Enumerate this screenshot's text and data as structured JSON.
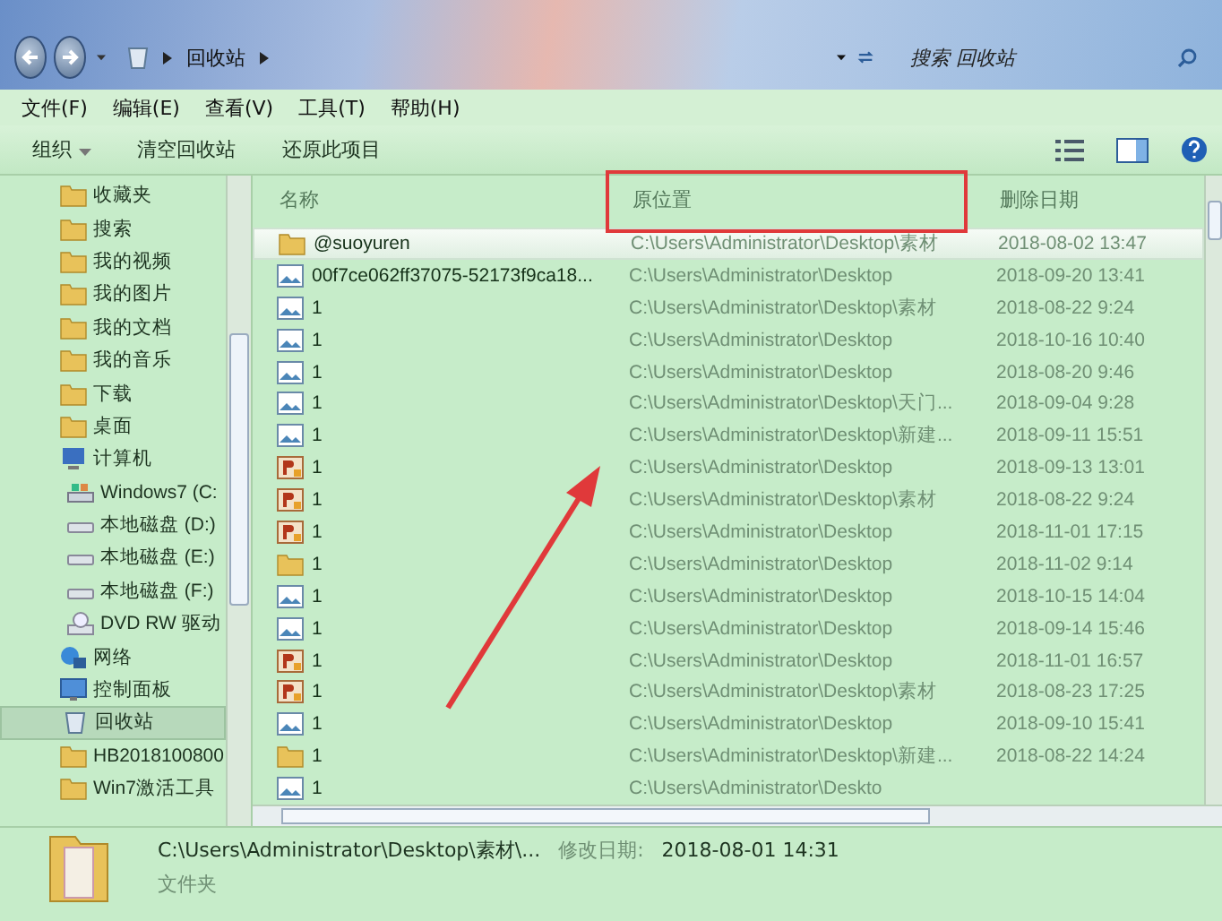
{
  "address_bar": {
    "crumbs": [
      "回收站"
    ],
    "search": {
      "placeholder": "搜索 回收站"
    }
  },
  "menu": [
    "文件(F)",
    "编辑(E)",
    "查看(V)",
    "工具(T)",
    "帮助(H)"
  ],
  "toolbar": {
    "organize": "组织",
    "buttons": [
      "清空回收站",
      "还原此项目"
    ]
  },
  "sidebar": {
    "items": [
      {
        "label": "收藏夹",
        "kind": "folder",
        "selected": false
      },
      {
        "label": "搜索",
        "kind": "folder",
        "selected": false
      },
      {
        "label": "我的视频",
        "kind": "folder",
        "selected": false
      },
      {
        "label": "我的图片",
        "kind": "folder",
        "selected": false
      },
      {
        "label": "我的文档",
        "kind": "folder",
        "selected": false
      },
      {
        "label": "我的音乐",
        "kind": "folder",
        "selected": false
      },
      {
        "label": "下载",
        "kind": "folder",
        "selected": false
      },
      {
        "label": "桌面",
        "kind": "folder",
        "selected": false
      },
      {
        "label": "计算机",
        "kind": "computer",
        "selected": false,
        "children": [
          {
            "label": "Windows7 (C:",
            "kind": "system-drive",
            "selected": false
          },
          {
            "label": "本地磁盘 (D:)",
            "kind": "drive",
            "selected": false
          },
          {
            "label": "本地磁盘 (E:)",
            "kind": "drive",
            "selected": false
          },
          {
            "label": "本地磁盘 (F:)",
            "kind": "drive",
            "selected": false
          },
          {
            "label": "DVD RW 驱动",
            "kind": "dvd",
            "selected": false
          }
        ]
      },
      {
        "label": "网络",
        "kind": "network",
        "selected": false
      },
      {
        "label": "控制面板",
        "kind": "panel",
        "selected": false
      },
      {
        "label": "回收站",
        "kind": "bin",
        "selected": true
      },
      {
        "label": "HB2018100800",
        "kind": "folder",
        "selected": false
      },
      {
        "label": "Win7激活工具",
        "kind": "folder",
        "selected": false
      }
    ]
  },
  "table": {
    "columns": [
      "名称",
      "原位置",
      "删除日期"
    ],
    "rows": [
      {
        "kind": "folder",
        "name": "@suoyuren",
        "location": "C:\\Users\\Administrator\\Desktop\\素材",
        "date": "2018-08-02 13:47",
        "selected": true
      },
      {
        "kind": "image",
        "name": "00f7ce062ff37075-52173f9ca18...",
        "location": "C:\\Users\\Administrator\\Desktop",
        "date": "2018-09-20 13:41",
        "selected": false
      },
      {
        "kind": "image",
        "name": "1",
        "location": "C:\\Users\\Administrator\\Desktop\\素材",
        "date": "2018-08-22 9:24",
        "selected": false
      },
      {
        "kind": "image",
        "name": "1",
        "location": "C:\\Users\\Administrator\\Desktop",
        "date": "2018-10-16 10:40",
        "selected": false
      },
      {
        "kind": "image",
        "name": "1",
        "location": "C:\\Users\\Administrator\\Desktop",
        "date": "2018-08-20 9:46",
        "selected": false
      },
      {
        "kind": "image",
        "name": "1",
        "location": "C:\\Users\\Administrator\\Desktop\\天门...",
        "date": "2018-09-04 9:28",
        "selected": false
      },
      {
        "kind": "image",
        "name": "1",
        "location": "C:\\Users\\Administrator\\Desktop\\新建...",
        "date": "2018-09-11 15:51",
        "selected": false
      },
      {
        "kind": "psd",
        "name": "1",
        "location": "C:\\Users\\Administrator\\Desktop",
        "date": "2018-09-13 13:01",
        "selected": false
      },
      {
        "kind": "psd",
        "name": "1",
        "location": "C:\\Users\\Administrator\\Desktop\\素材",
        "date": "2018-08-22 9:24",
        "selected": false
      },
      {
        "kind": "psd",
        "name": "1",
        "location": "C:\\Users\\Administrator\\Desktop",
        "date": "2018-11-01 17:15",
        "selected": false
      },
      {
        "kind": "folder",
        "name": "1",
        "location": "C:\\Users\\Administrator\\Desktop",
        "date": "2018-11-02 9:14",
        "selected": false
      },
      {
        "kind": "image",
        "name": "1",
        "location": "C:\\Users\\Administrator\\Desktop",
        "date": "2018-10-15 14:04",
        "selected": false
      },
      {
        "kind": "image",
        "name": "1",
        "location": "C:\\Users\\Administrator\\Desktop",
        "date": "2018-09-14 15:46",
        "selected": false
      },
      {
        "kind": "psd",
        "name": "1",
        "location": "C:\\Users\\Administrator\\Desktop",
        "date": "2018-11-01 16:57",
        "selected": false
      },
      {
        "kind": "psd",
        "name": "1",
        "location": "C:\\Users\\Administrator\\Desktop\\素材",
        "date": "2018-08-23 17:25",
        "selected": false
      },
      {
        "kind": "image",
        "name": "1",
        "location": "C:\\Users\\Administrator\\Desktop",
        "date": "2018-09-10 15:41",
        "selected": false
      },
      {
        "kind": "folder",
        "name": "1",
        "location": "C:\\Users\\Administrator\\Desktop\\新建...",
        "date": "2018-08-22 14:24",
        "selected": false
      },
      {
        "kind": "image",
        "name": "1",
        "location": "C:\\Users\\Administrator\\Deskto",
        "selected": false
      }
    ]
  },
  "details": {
    "path": "C:\\Users\\Administrator\\Desktop\\素材\\...",
    "modified_label": "修改日期:",
    "modified": "2018-08-01 14:31",
    "type": "文件夹"
  },
  "annotations": {
    "highlight_box": true,
    "arrow": true
  }
}
